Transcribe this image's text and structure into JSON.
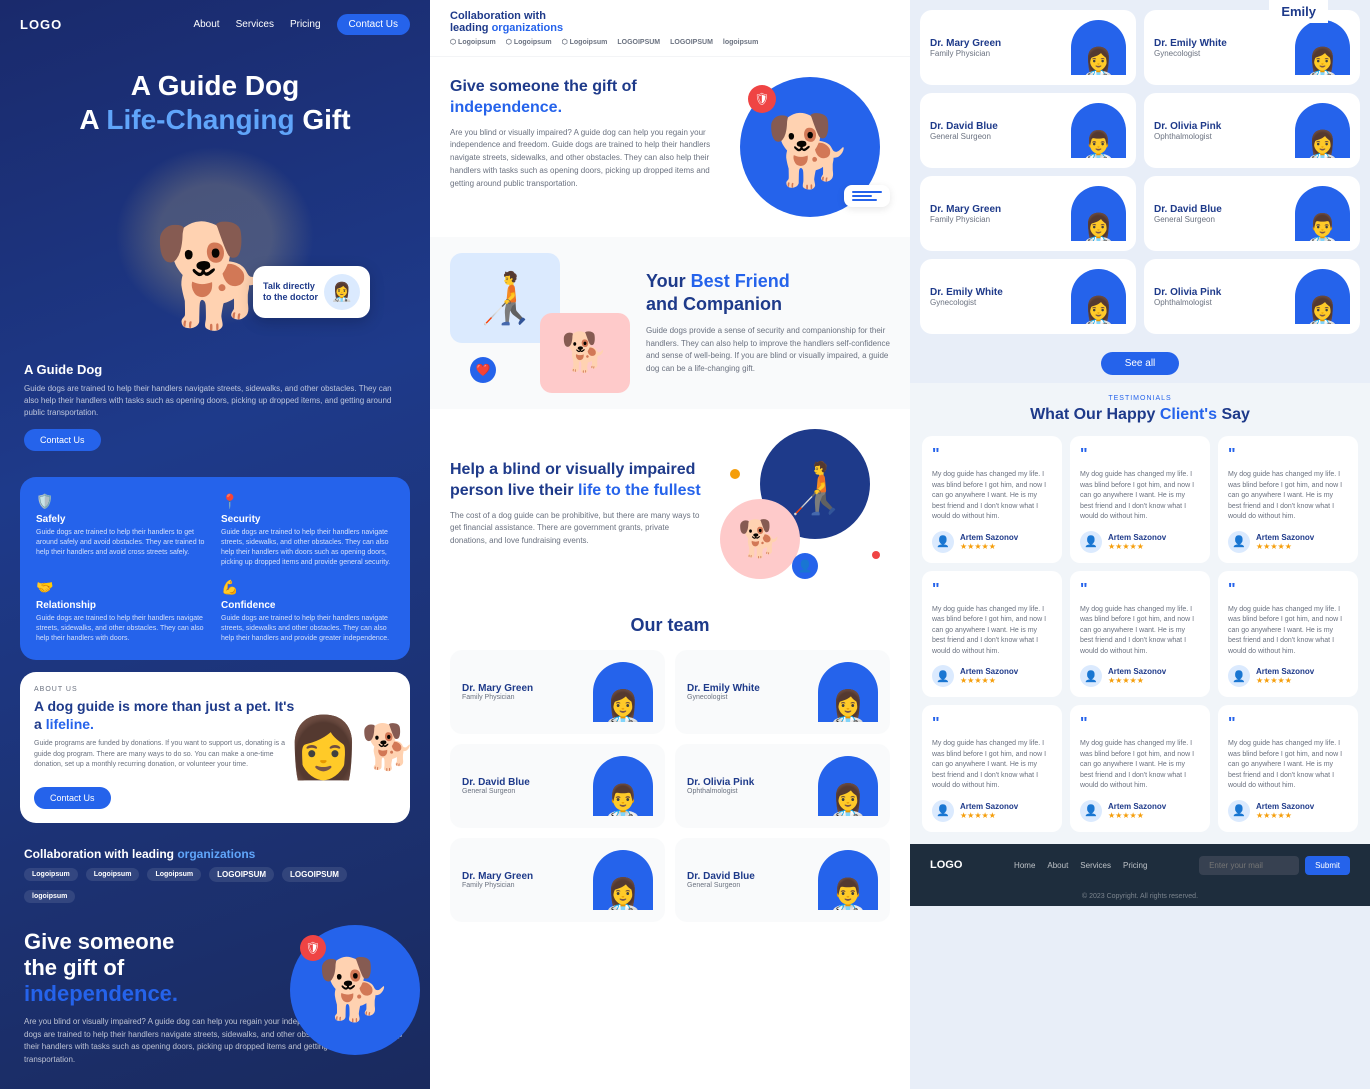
{
  "emily": "Emily",
  "navbar": {
    "logo": "LOGO",
    "links": [
      "About",
      "Services",
      "Pricing"
    ],
    "cta": "Contact Us"
  },
  "hero": {
    "line1": "A Guide Dog",
    "line2_normal": "A ",
    "line2_highlight": "Life-Changing",
    "line2_end": " Gift"
  },
  "guide_dog": {
    "title": "A Guide Dog",
    "desc": "Guide dogs are trained to help their handlers navigate streets, sidewalks, and other obstacles. They can also help their handlers with tasks such as opening doors, picking up dropped items, and getting around public transportation.",
    "cta": "Contact Us"
  },
  "features": [
    {
      "icon": "🛡️",
      "title": "Safely",
      "desc": "Guide dogs are trained to help their handlers to get around safely and avoid obstacles. They are trained to help their handlers and avoid cross streets safely."
    },
    {
      "icon": "📍",
      "title": "Security",
      "desc": "Guide dogs are trained to help their handlers navigate streets, sidewalks, and other obstacles. They can also help their handlers with doors such as opening doors, picking up dropped items and provide general security."
    },
    {
      "icon": "🤝",
      "title": "Relationship",
      "desc": "Guide dogs are trained to help their handlers navigate streets, sidewalks, and other obstacles. They can also help their handlers with doors."
    },
    {
      "icon": "💪",
      "title": "Confidence",
      "desc": "Guide dogs are trained to help their handlers navigate streets, sidewalks and other obstacles. They can also help their handlers and provide greater independence."
    }
  ],
  "lifeline": {
    "tag": "ABOUT US",
    "title_normal": "A dog guide is more than just a pet. It's a ",
    "title_highlight": "lifeline.",
    "desc": "Guide programs are funded by donations. If you want to support us, donating is a guide dog program. There are many ways to do so. You can make a one-time donation, set up a monthly recurring donation, or volunteer your time.",
    "cta": "Contact Us"
  },
  "collab_left": {
    "title_normal": "Collaboration with leading ",
    "title_highlight": "organizations",
    "logos": [
      "Logoipsum",
      "Logoipsum",
      "Logoipsum",
      "LOGOIPSUM",
      "LOGOIPSUM",
      "logoipsum"
    ]
  },
  "gift": {
    "title_normal": "Give someone\nthe gift of\n",
    "title_highlight": "independence.",
    "desc": "Are you blind or visually impaired? A guide dog can help you regain your independence and freedom. Guide dogs are trained to help their handlers navigate streets, sidewalks, and other obstacles. They can also help their handlers with tasks such as opening doors, picking up dropped items and getting around public transportation."
  },
  "independence": {
    "title_normal": "Give someone the gift of ",
    "title_highlight": "independence.",
    "desc": "Are you blind or visually impaired? A guide dog can help you regain your independence and freedom. Guide dogs are trained to help their handlers navigate streets, sidewalks, and other obstacles. They can also help their handlers with tasks such as opening doors, picking up dropped items and getting around public transportation."
  },
  "best_friend": {
    "title_normal": "Your ",
    "title_highlight": "Best Friend",
    "title_end": "\nand Companion",
    "desc": "Guide dogs provide a sense of security and companionship for their handlers. They can also help to improve the handlers self-confidence and sense of well-being. If you are blind or visually impaired, a guide dog can be a life-changing gift."
  },
  "blind": {
    "title_normal": "Help a blind or visually impaired person live their ",
    "title_highlight": "life to the fullest",
    "desc": "The cost of a dog guide can be prohibitive, but there are many ways to get financial assistance. There are government grants, private donations, and love fundraising events."
  },
  "team": {
    "title": "Our team",
    "members": [
      {
        "name": "Dr. Mary Green",
        "specialty": "Family Physician",
        "emoji": "👩‍⚕️"
      },
      {
        "name": "Dr. Emily White",
        "specialty": "Gynecologist",
        "emoji": "👩‍⚕️"
      },
      {
        "name": "Dr. David Blue",
        "specialty": "General Surgeon",
        "emoji": "👨‍⚕️"
      },
      {
        "name": "Dr. Olivia Pink",
        "specialty": "Ophthalmologist",
        "emoji": "👩‍⚕️"
      },
      {
        "name": "Dr. Mary Green",
        "specialty": "Family Physician",
        "emoji": "👩‍⚕️"
      },
      {
        "name": "Dr. David Blue",
        "specialty": "General Surgeon",
        "emoji": "👨‍⚕️"
      }
    ]
  },
  "right_doctors": [
    {
      "name": "Dr. Mary Green",
      "specialty": "Family Physician",
      "emoji": "👩‍⚕️"
    },
    {
      "name": "Dr. Emily White",
      "specialty": "Gynecologist",
      "emoji": "👩‍⚕️"
    },
    {
      "name": "Dr. David Blue",
      "specialty": "General Surgeon",
      "emoji": "👨‍⚕️"
    },
    {
      "name": "Dr. Olivia Pink",
      "specialty": "Ophthalmologist",
      "emoji": "👩‍⚕️"
    },
    {
      "name": "Dr. Mary Green",
      "specialty": "Family Physician",
      "emoji": "👩‍⚕️"
    },
    {
      "name": "Dr. David Blue",
      "specialty": "General Surgeon",
      "emoji": "👨‍⚕️"
    },
    {
      "name": "Dr. Emily White",
      "specialty": "Gynecologist",
      "emoji": "👩‍⚕️"
    },
    {
      "name": "Dr. Olivia Pink",
      "specialty": "Ophthalmologist",
      "emoji": "👩‍⚕️"
    }
  ],
  "see_all": "See all",
  "testimonials": {
    "tag": "TESTIMONIALS",
    "title_normal": "What Our Happy ",
    "title_highlight": "Client's",
    "title_end": " Say",
    "items": [
      {
        "text": "My dog guide has changed my life. I was blind before I got him, and now I can go anywhere I want. He is my best friend and I don't know what I would do without him.",
        "author": "Artem Sazonov",
        "stars": "★★★★★"
      },
      {
        "text": "My dog guide has changed my life. I was blind before I got him, and now I can go anywhere I want. He is my best friend and I don't know what I would do without him.",
        "author": "Artem Sazonov",
        "stars": "★★★★★"
      },
      {
        "text": "My dog guide has changed my life. I was blind before I got him, and now I can go anywhere I want. He is my best friend and I don't know what I would do without him.",
        "author": "Artem Sazonov",
        "stars": "★★★★★"
      },
      {
        "text": "My dog guide has changed my life. I was blind before I got him, and now I can go anywhere I want. He is my best friend and I don't know what I would do without him.",
        "author": "Artem Sazonov",
        "stars": "★★★★★"
      },
      {
        "text": "My dog guide has changed my life. I was blind before I got him, and now I can go anywhere I want. He is my best friend and I don't know what I would do without him.",
        "author": "Artem Sazonov",
        "stars": "★★★★★"
      },
      {
        "text": "My dog guide has changed my life. I was blind before I got him, and now I can go anywhere I want. He is my best friend and I don't know what I would do without him.",
        "author": "Artem Sazonov",
        "stars": "★★★★★"
      },
      {
        "text": "My dog guide has changed my life. I was blind before I got him, and now I can go anywhere I want. He is my best friend and I don't know what I would do without him.",
        "author": "Artem Sazonov",
        "stars": "★★★★★"
      },
      {
        "text": "My dog guide has changed my life. I was blind before I got him, and now I can go anywhere I want. He is my best friend and I don't know what I would do without him.",
        "author": "Artem Sazonov",
        "stars": "★★★★★"
      },
      {
        "text": "My dog guide has changed my life. I was blind before I got him, and now I can go anywhere I want. He is my best friend and I don't know what I would do without him.",
        "author": "Artem Sazonov",
        "stars": "★★★★★"
      }
    ]
  },
  "footer": {
    "logo": "LOGO",
    "links": [
      "Home",
      "About",
      "Services",
      "Pricing"
    ],
    "newsletter_placeholder": "Enter your mail",
    "submit": "Submit",
    "copyright": "© 2023 Copyright. All rights reserved."
  },
  "doctor_bubble": {
    "text": "Talk directly\nto the doctor",
    "emoji": "👩‍⚕️"
  },
  "collab_mid": {
    "title_normal": "Collaboration with\nleading ",
    "title_highlight": "organizations",
    "logos": [
      "Logoipsum",
      "Logoipsum",
      "Logoipsum",
      "LOGOIPSUM",
      "LOGOIPSUM",
      "logoipsum"
    ]
  }
}
